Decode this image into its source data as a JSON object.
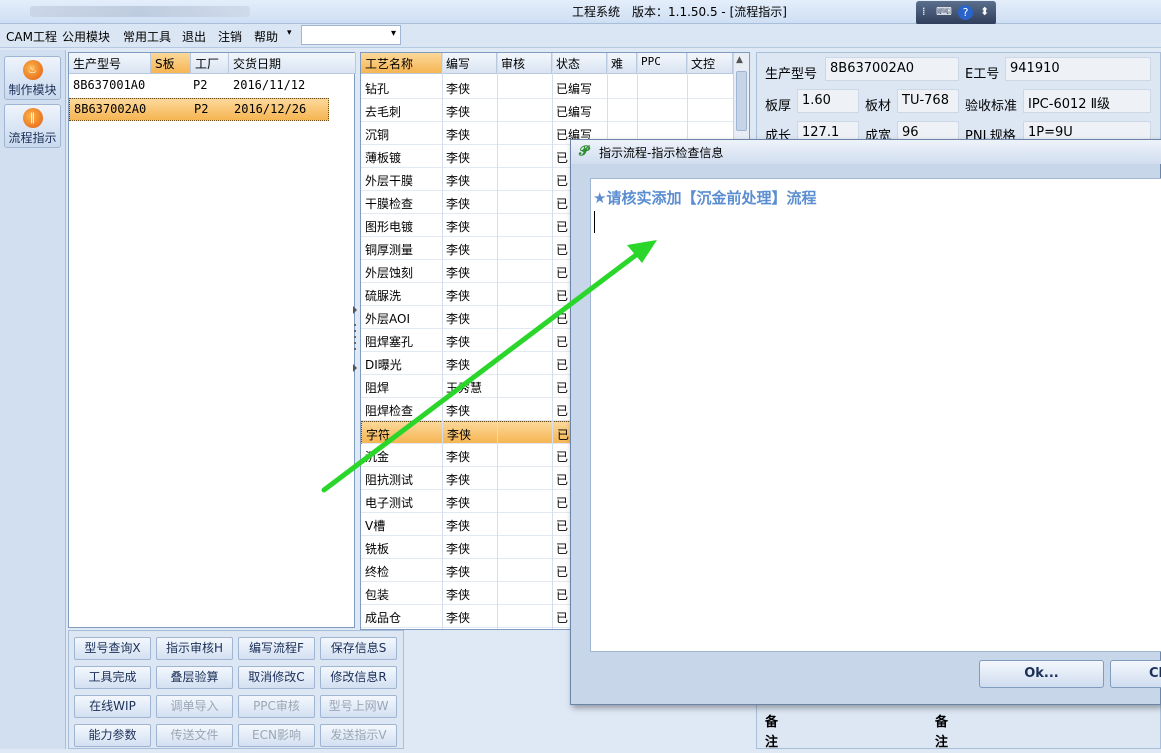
{
  "window": {
    "title": "工程系统　版本：1.1.50.5 - [流程指示]"
  },
  "tray": {
    "icons": [
      "keyboard-icon",
      "help-icon",
      "menu-icon"
    ]
  },
  "menu": {
    "items": [
      "CAM工程",
      "公用模块",
      "常用工具",
      "退出",
      "注销",
      "帮助"
    ],
    "help_arrow": "▾",
    "combo_value": ""
  },
  "sidebar": {
    "items": [
      {
        "label": "制作模块",
        "icon": "flame-icon"
      },
      {
        "label": "流程指示",
        "icon": "pause-icon"
      }
    ]
  },
  "products": {
    "headers": [
      "生产型号",
      "S板",
      "工厂",
      "交货日期"
    ],
    "rows": [
      [
        "8B637001A0",
        "",
        "P2",
        "2016/11/12"
      ],
      [
        "8B637002A0",
        "",
        "P2",
        "2016/12/26"
      ]
    ],
    "selected": 1
  },
  "process": {
    "headers": [
      "工艺名称",
      "编写",
      "审核",
      "状态",
      "难",
      "PPC",
      "文控"
    ],
    "rows": [
      [
        "钻孔",
        "李侠",
        "",
        "已编写"
      ],
      [
        "去毛刺",
        "李侠",
        "",
        "已编写"
      ],
      [
        "沉铜",
        "李侠",
        "",
        "已编写"
      ],
      [
        "薄板镀",
        "李侠",
        "",
        "已"
      ],
      [
        "外层干膜",
        "李侠",
        "",
        "已"
      ],
      [
        "干膜检查",
        "李侠",
        "",
        "已"
      ],
      [
        "图形电镀",
        "李侠",
        "",
        "已"
      ],
      [
        "铜厚测量",
        "李侠",
        "",
        "已"
      ],
      [
        "外层蚀刻",
        "李侠",
        "",
        "已"
      ],
      [
        "硫脲洗",
        "李侠",
        "",
        "已"
      ],
      [
        "外层AOI",
        "李侠",
        "",
        "已"
      ],
      [
        "阻焊塞孔",
        "李侠",
        "",
        "已"
      ],
      [
        "DI曝光",
        "李侠",
        "",
        "已"
      ],
      [
        "阻焊",
        "王秀慧",
        "",
        "已"
      ],
      [
        "阻焊检查",
        "李侠",
        "",
        "已"
      ],
      [
        "字符",
        "李侠",
        "",
        "已"
      ],
      [
        "沉金",
        "李侠",
        "",
        "已"
      ],
      [
        "阻抗测试",
        "李侠",
        "",
        "已"
      ],
      [
        "电子测试",
        "李侠",
        "",
        "已"
      ],
      [
        "V槽",
        "李侠",
        "",
        "已"
      ],
      [
        "铣板",
        "李侠",
        "",
        "已"
      ],
      [
        "终检",
        "李侠",
        "",
        "已"
      ],
      [
        "包装",
        "李侠",
        "",
        "已"
      ],
      [
        "成品仓",
        "李侠",
        "",
        "已"
      ]
    ],
    "selected": 15
  },
  "info": {
    "model_label": "生产型号",
    "model": "8B637002A0",
    "eno_label": "E工号",
    "eno": "941910",
    "thick_label": "板厚",
    "thick": "1.60",
    "mat_label": "板材",
    "mat": "TU-768",
    "std_label": "验收标准",
    "std": "IPC-6012 Ⅱ级",
    "len_label": "成长",
    "len": "127.1",
    "wid_label": "成宽",
    "wid": "96",
    "pnl_label": "PNL规格",
    "pnl": "1P=9U",
    "note1": "备注",
    "note2": "备注"
  },
  "buttons": [
    {
      "label": "型号查询X",
      "enabled": true
    },
    {
      "label": "指示审核H",
      "enabled": true
    },
    {
      "label": "编写流程F",
      "enabled": true
    },
    {
      "label": "保存信息S",
      "enabled": true
    },
    {
      "label": "工具完成",
      "enabled": true
    },
    {
      "label": "叠层验算",
      "enabled": true
    },
    {
      "label": "取消修改C",
      "enabled": true
    },
    {
      "label": "修改信息R",
      "enabled": true
    },
    {
      "label": "在线WIP",
      "enabled": true
    },
    {
      "label": "调单导入",
      "enabled": false
    },
    {
      "label": "PPC审核",
      "enabled": false
    },
    {
      "label": "型号上网W",
      "enabled": false
    },
    {
      "label": "能力参数",
      "enabled": true
    },
    {
      "label": "传送文件",
      "enabled": false
    },
    {
      "label": "ECN影响",
      "enabled": false
    },
    {
      "label": "发送指示V",
      "enabled": false
    }
  ],
  "dialog": {
    "title": "指示流程-指示检查信息",
    "message": "★请核实添加【沉金前处理】流程",
    "ok_label": "Ok...",
    "close_label": "Cl"
  },
  "colors": {
    "arrow": "#2bd62b",
    "selection": "#f6b552",
    "message": "#5b8ed0"
  }
}
